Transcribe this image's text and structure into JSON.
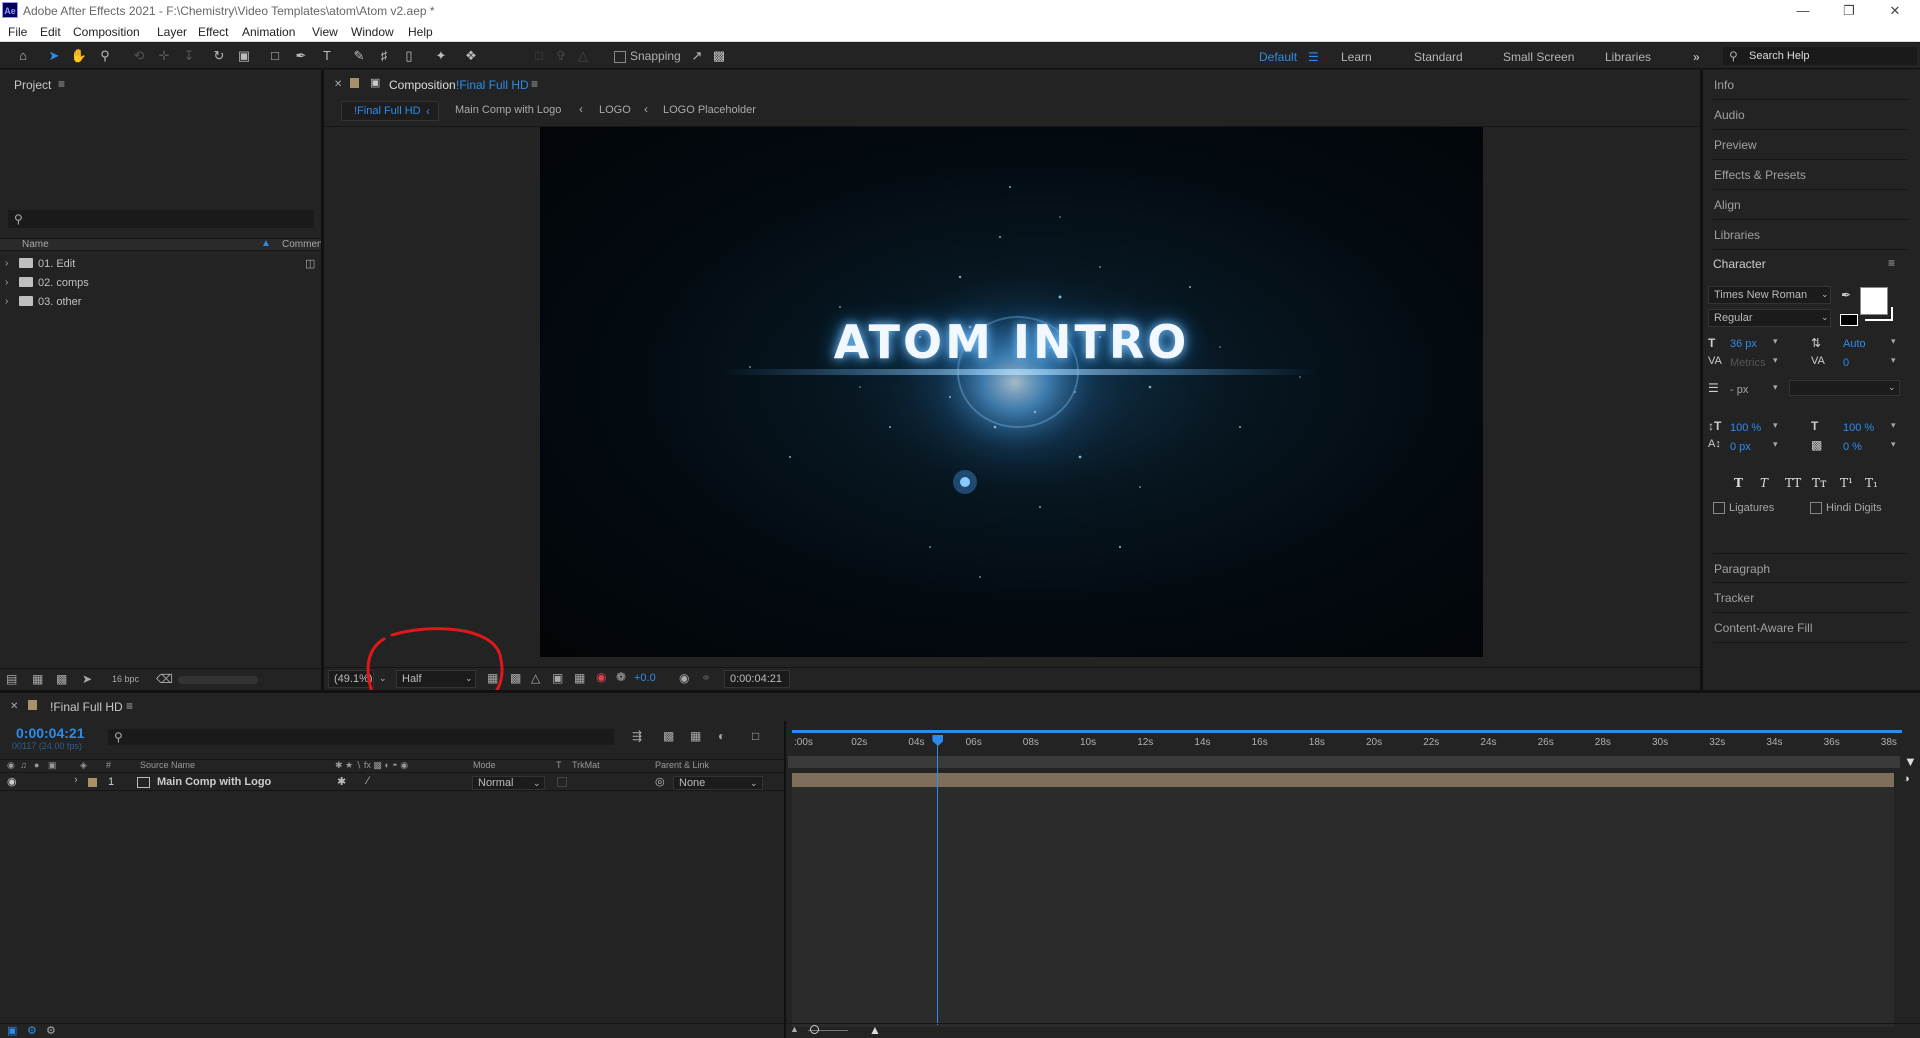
{
  "app": {
    "title": "Adobe After Effects 2021 - F:\\Chemistry\\Video Templates\\atom\\Atom v2.aep *",
    "icon_text": "Ae"
  },
  "menu": [
    "File",
    "Edit",
    "Composition",
    "Layer",
    "Effect",
    "Animation",
    "View",
    "Window",
    "Help"
  ],
  "toolbar": {
    "snapping_label": "Snapping",
    "workspaces": [
      "Default",
      "Learn",
      "Standard",
      "Small Screen",
      "Libraries"
    ],
    "search_placeholder": "Search Help"
  },
  "project": {
    "tab": "Project",
    "columns": [
      "Name",
      "Commen"
    ],
    "items": [
      "01. Edit",
      "02. comps",
      "03. other"
    ],
    "bpc": "16 bpc"
  },
  "composition": {
    "tab_prefix": "Composition",
    "tab_name": "!Final Full HD",
    "breadcrumbs": [
      "!Final Full HD",
      "Main Comp with Logo",
      "LOGO",
      "LOGO Placeholder"
    ],
    "title_text": "ATOM INTRO",
    "zoom": "(49.1%)",
    "resolution": "Half",
    "exposure": "+0.0",
    "timecode": "0:00:04:21"
  },
  "right_panels": {
    "top": [
      "Info",
      "Audio",
      "Preview",
      "Effects & Presets",
      "Align",
      "Libraries"
    ],
    "character": {
      "title": "Character",
      "font": "Times New Roman",
      "style": "Regular",
      "size": "36 px",
      "leading": "Auto",
      "kerning": "Metrics",
      "tracking": "0",
      "stroke": "- px",
      "vscale": "100 %",
      "hscale": "100 %",
      "baseline": "0 px",
      "tsume": "0 %",
      "styles": [
        "T",
        "T",
        "TT",
        "Tт",
        "T¹",
        "T₁"
      ],
      "ligatures": "Ligatures",
      "hindi": "Hindi Digits"
    },
    "bottom": [
      "Paragraph",
      "Tracker",
      "Content-Aware Fill"
    ]
  },
  "timeline": {
    "tab": "!Final Full HD",
    "timecode": "0:00:04:21",
    "frame_info": "00117 (24.00 fps)",
    "columns": {
      "hash": "#",
      "source": "Source Name",
      "mode": "Mode",
      "t": "T",
      "trkmat": "TrkMat",
      "parent": "Parent & Link"
    },
    "layer": {
      "index": "1",
      "name": "Main Comp with Logo",
      "mode": "Normal",
      "parent": "None"
    },
    "ticks": [
      ":00s",
      "02s",
      "04s",
      "06s",
      "08s",
      "10s",
      "12s",
      "14s",
      "16s",
      "18s",
      "20s",
      "22s",
      "24s",
      "26s",
      "28s",
      "30s",
      "32s",
      "34s",
      "36s",
      "38s"
    ],
    "playhead_seconds": 4.875
  },
  "colors": {
    "accent": "#2d8ceb",
    "annotation": "#e0171b",
    "layer_bar": "#7d6f5a"
  }
}
